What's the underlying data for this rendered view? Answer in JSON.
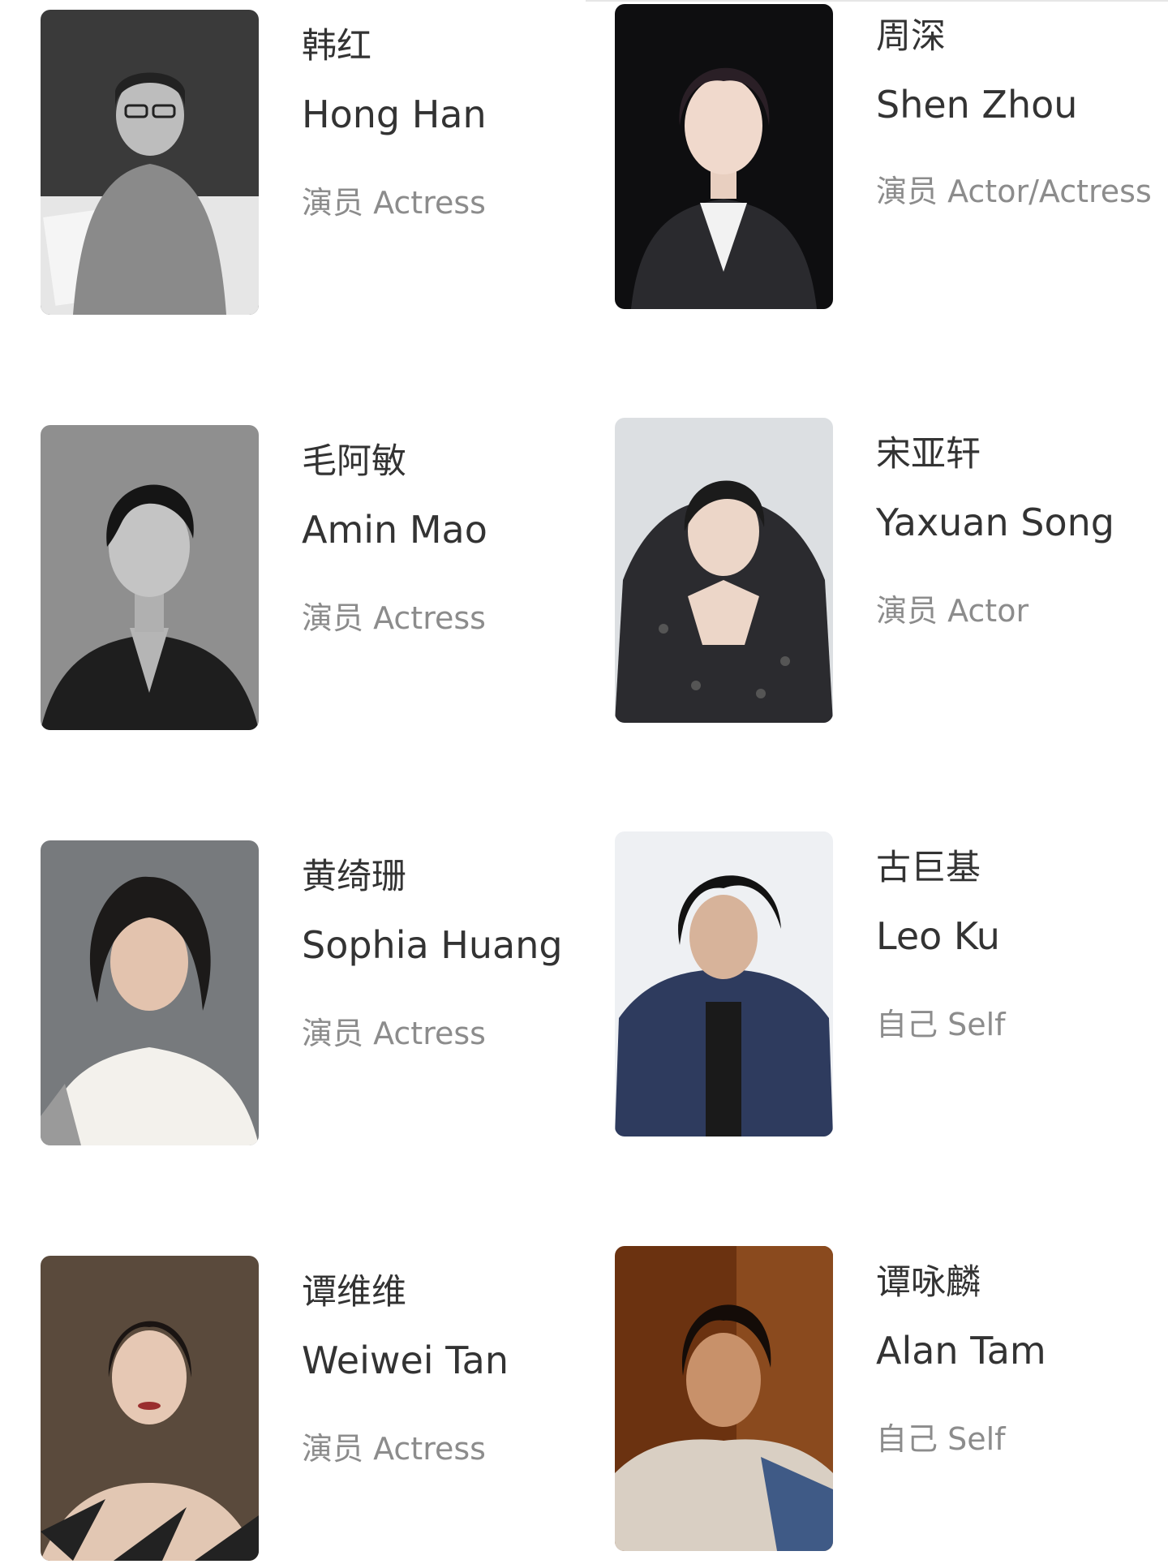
{
  "cast": [
    {
      "name_cn": "韩红",
      "name_en": "Hong Han",
      "role": "演员 Actress"
    },
    {
      "name_cn": "周深",
      "name_en": "Shen Zhou",
      "role": "演员 Actor/Actress"
    },
    {
      "name_cn": "毛阿敏",
      "name_en": "Amin Mao",
      "role": "演员 Actress"
    },
    {
      "name_cn": "宋亚轩",
      "name_en": "Yaxuan Song",
      "role": "演员 Actor"
    },
    {
      "name_cn": "黄绮珊",
      "name_en": "Sophia Huang",
      "role": "演员 Actress"
    },
    {
      "name_cn": "古巨基",
      "name_en": "Leo Ku",
      "role": "自己 Self"
    },
    {
      "name_cn": "谭维维",
      "name_en": "Weiwei Tan",
      "role": "演员 Actress"
    },
    {
      "name_cn": "谭咏麟",
      "name_en": "Alan Tam",
      "role": "自己 Self"
    }
  ]
}
